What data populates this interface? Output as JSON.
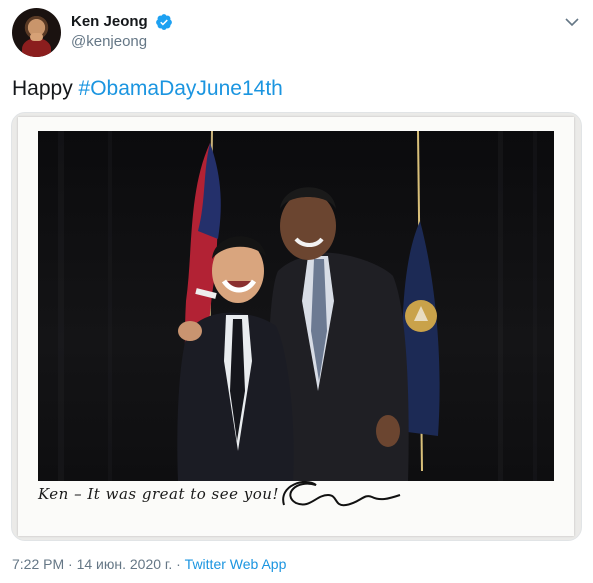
{
  "author": {
    "display_name": "Ken Jeong",
    "handle": "@kenjeong",
    "verified": true,
    "avatar_icon": "avatar-photo"
  },
  "tweet": {
    "text_prefix": "Happy ",
    "hashtag": "#ObamaDayJune14th"
  },
  "media": {
    "handwritten_note": "Ken – It was great to see you!"
  },
  "meta": {
    "time": "7:22 PM",
    "separator": "·",
    "date": "14 июн. 2020 г.",
    "source": "Twitter Web App"
  },
  "colors": {
    "link": "#1b95e0",
    "secondary_text": "#657786",
    "primary_text": "#14171a",
    "verified": "#1da1f2"
  },
  "icons": {
    "verified": "verified-badge-icon",
    "menu": "chevron-down-icon"
  }
}
